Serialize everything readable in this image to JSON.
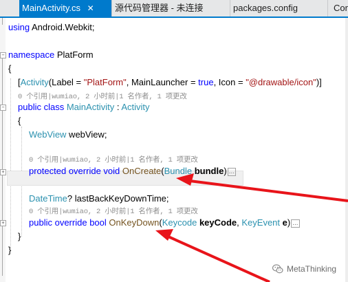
{
  "tabs": [
    {
      "label": "MainActivity.cs",
      "close": "✕",
      "active": true
    },
    {
      "label": "源代码管理器 - 未连接"
    },
    {
      "label": "packages.config"
    },
    {
      "label": "Conf"
    }
  ],
  "code": {
    "using": {
      "kw": "using",
      "ns": "Android.Webkit;"
    },
    "namespace": {
      "kw": "namespace",
      "name": "PlatForm"
    },
    "brace_open": "{",
    "brace_close": "}",
    "attribute": {
      "open": "[",
      "name": "Activity",
      "p1": "(Label = ",
      "label_value": "\"PlatForm\"",
      "p2": ", MainLauncher = ",
      "true_kw": "true",
      "p3": ", Icon = ",
      "icon_value": "\"@drawable/icon\"",
      "p4": ")]"
    },
    "lens_class": "0 个引用|wumiao, 2 小时前|1 名作者, 1 项更改",
    "class_decl": {
      "kw1": "public",
      "kw2": "class",
      "name": "MainActivity",
      "colon": " : ",
      "base": "Activity"
    },
    "field": {
      "type": "WebView",
      "name": " webView;"
    },
    "lens_oncreate": "0 个引用|wumiao, 2 小时前|1 名作者, 1 项更改",
    "oncreate": {
      "kw1": "protected",
      "kw2": "override",
      "kw3": "void",
      "name": "OnCreate",
      "paren": "(",
      "ptype": "Bundle",
      "pname": "bundle",
      "close": ")",
      "collapsed": "..."
    },
    "datetime": {
      "type": "DateTime",
      "rest": "? lastBackKeyDownTime;"
    },
    "lens_onkeydown": "0 个引用|wumiao, 2 小时前|1 名作者, 1 项更改",
    "onkeydown": {
      "kw1": "public",
      "kw2": "override",
      "kw3": "bool",
      "name": "OnKeyDown",
      "paren": "(",
      "ptype1": "Keycode",
      "pname1": "keyCode",
      "comma": ", ",
      "ptype2": "KeyEvent",
      "pname2": "e",
      "close": ")",
      "collapsed": "..."
    }
  },
  "watermark": {
    "text": "MetaThinking",
    "icon": "wechat-icon"
  },
  "colors": {
    "accent": "#007acc",
    "keyword": "#0000ff",
    "type": "#2b91af",
    "string": "#a31515",
    "method": "#74531f",
    "arrow": "#e8141a"
  }
}
